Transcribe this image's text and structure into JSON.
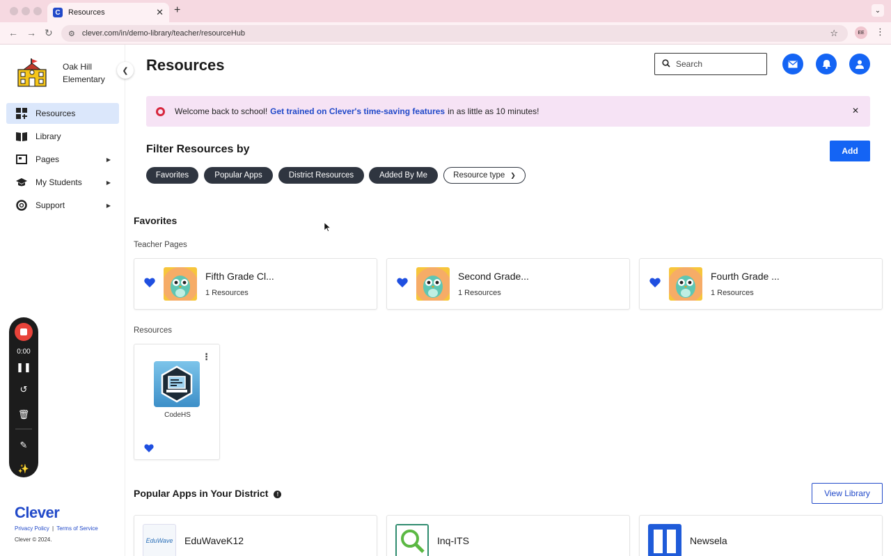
{
  "browser": {
    "tab_title": "Resources",
    "tab_favicon": "C",
    "url": "clever.com/in/demo-library/teacher/resourceHub",
    "profile_initials": "EE"
  },
  "sidebar": {
    "school_name": "Oak Hill Elementary",
    "items": [
      {
        "label": "Resources",
        "icon": "grid-icon",
        "active": true
      },
      {
        "label": "Library",
        "icon": "book-icon"
      },
      {
        "label": "Pages",
        "icon": "pages-icon",
        "has_submenu": true
      },
      {
        "label": "My Students",
        "icon": "graduation-cap-icon",
        "has_submenu": true
      },
      {
        "label": "Support",
        "icon": "support-icon",
        "has_submenu": true
      }
    ],
    "recorder": {
      "time": "0:00"
    },
    "footer": {
      "logo": "Clever",
      "privacy": "Privacy Policy",
      "separator": "|",
      "terms": "Terms of Service",
      "copyright": "Clever © 2024."
    }
  },
  "header": {
    "title": "Resources",
    "search_placeholder": "Search"
  },
  "banner": {
    "prefix": "Welcome back to school!",
    "link": "Get trained on Clever's time-saving features",
    "suffix": "in as little as 10 minutes!"
  },
  "filters": {
    "title": "Filter Resources by",
    "add_label": "Add",
    "chips": [
      "Favorites",
      "Popular Apps",
      "District Resources",
      "Added By Me"
    ],
    "dropdown": "Resource type"
  },
  "favorites": {
    "title": "Favorites",
    "teacher_pages_label": "Teacher Pages",
    "pages": [
      {
        "title": "Fifth Grade Cl...",
        "count": "1 Resources"
      },
      {
        "title": "Second Grade...",
        "count": "1 Resources"
      },
      {
        "title": "Fourth Grade ...",
        "count": "1 Resources"
      }
    ],
    "resources_label": "Resources",
    "resources": [
      {
        "name": "CodeHS"
      }
    ]
  },
  "popular": {
    "title": "Popular Apps in Your District",
    "view_library": "View Library",
    "apps": [
      {
        "name": "EduWaveK12",
        "thumb_text": "EduWave"
      },
      {
        "name": "Inq-ITS"
      },
      {
        "name": "Newsela"
      }
    ]
  },
  "colors": {
    "primary": "#1464f4",
    "link": "#2149c9",
    "banner_bg": "#f6e3f5",
    "chip_bg": "#2f3540",
    "active_nav_bg": "#dbe7fb"
  }
}
